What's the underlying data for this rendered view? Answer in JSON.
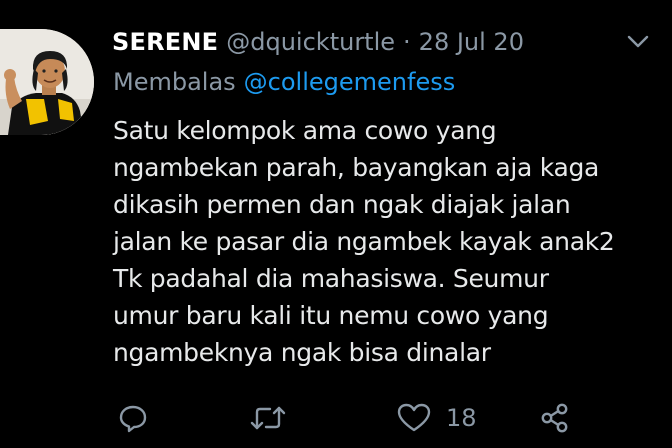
{
  "tweet": {
    "author_name": "SERENE",
    "author_handle": "@dquickturtle",
    "separator": "·",
    "date": "28 Jul 20",
    "reply_prefix": "Membalas",
    "reply_to": "@collegemenfess",
    "body_lines": [
      "Satu kelompok ama cowo yang",
      "ngambekan parah, bayangkan aja kaga",
      "dikasih permen dan ngak diajak jalan",
      "jalan ke pasar dia ngambek kayak anak2",
      "Tk padahal dia mahasiswa. Seumur",
      "umur baru kali itu nemu cowo yang",
      "ngambeknya ngak bisa dinalar"
    ],
    "like_count": "18"
  },
  "icons": {
    "caret": "chevron-down-icon",
    "reply": "reply-bubble-icon",
    "retweet": "retweet-icon",
    "like": "heart-icon",
    "share": "share-icon"
  },
  "colors": {
    "background": "#000000",
    "text": "#e7e9ea",
    "muted": "#8b98a5",
    "link": "#1d9bf0"
  }
}
